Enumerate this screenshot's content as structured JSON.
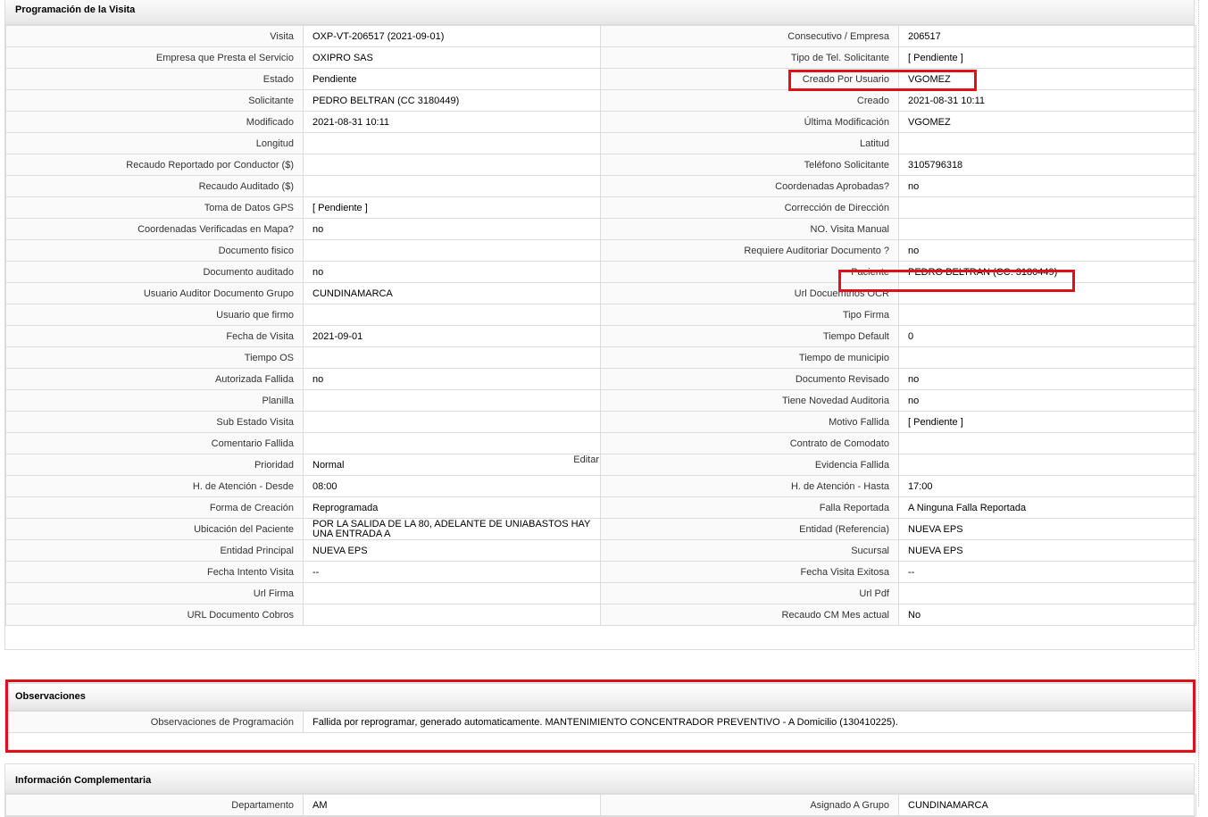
{
  "sections": {
    "programacion": {
      "title": "Programación de la Visita",
      "rows": [
        {
          "l1": "Visita",
          "v1": "OXP-VT-206517 (2021-09-01)",
          "l2": "Consecutivo / Empresa",
          "v2": "206517"
        },
        {
          "l1": "Empresa que Presta el Servicio",
          "v1": "OXIPRO SAS",
          "l2": "Tipo de Tel. Solicitante",
          "v2": "[ Pendiente ]"
        },
        {
          "l1": "Estado",
          "v1": "Pendiente",
          "l2": "Creado Por Usuario",
          "v2": "VGOMEZ"
        },
        {
          "l1": "Solicitante",
          "v1": "PEDRO BELTRAN (CC 3180449)",
          "l2": "Creado",
          "v2": "2021-08-31 10:11"
        },
        {
          "l1": "Modificado",
          "v1": "2021-08-31 10:11",
          "l2": "Última Modificación",
          "v2": " VGOMEZ"
        },
        {
          "l1": "Longitud",
          "v1": "",
          "l2": "Latitud",
          "v2": ""
        },
        {
          "l1": "Recaudo Reportado por Conductor ($)",
          "v1": "",
          "l2": "Teléfono Solicitante",
          "v2": "3105796318"
        },
        {
          "l1": "Recaudo Auditado ($)",
          "v1": "",
          "l2": "Coordenadas Aprobadas?",
          "v2": " no"
        },
        {
          "l1": "Toma de Datos GPS",
          "v1": "[ Pendiente ]",
          "l2": "Corrección de Dirección",
          "v2": ""
        },
        {
          "l1": "Coordenadas Verificadas en Mapa?",
          "v1": " no",
          "l2": "NO. Visita Manual",
          "v2": ""
        },
        {
          "l1": "Documento fisico",
          "v1": "",
          "l2": "Requiere Auditoriar Documento ?",
          "v2": " no"
        },
        {
          "l1": "Documento auditado",
          "v1": " no",
          "l2": "Paciente",
          "v2": "PEDRO BELTRAN (CC: 3180449)"
        },
        {
          "l1": "Usuario Auditor Documento Grupo",
          "v1": "CUNDINAMARCA",
          "l2": "Url Docuemtnos OCR",
          "v2": ""
        },
        {
          "l1": "Usuario que firmo",
          "v1": "",
          "l2": "Tipo Firma",
          "v2": ""
        },
        {
          "l1": "Fecha de Visita",
          "v1": " 2021-09-01",
          "l2": "Tiempo Default",
          "v2": "0"
        },
        {
          "l1": "Tiempo OS",
          "v1": "",
          "l2": "Tiempo de municipio",
          "v2": ""
        },
        {
          "l1": "Autorizada Fallida",
          "v1": " no",
          "l2": "Documento Revisado",
          "v2": " no"
        },
        {
          "l1": "Planilla",
          "v1": "",
          "l2": "Tiene Novedad Auditoria",
          "v2": " no"
        },
        {
          "l1": "Sub Estado Visita",
          "v1": "",
          "l2": "Motivo Fallida",
          "v2": "[ Pendiente ]"
        },
        {
          "l1": "Comentario Fallida",
          "v1": "",
          "l2": "Contrato de Comodato",
          "v2": ""
        },
        {
          "l1": "Prioridad",
          "v1": "Normal",
          "l2": "Evidencia Fallida",
          "v2": ""
        },
        {
          "l1": "H. de Atención - Desde",
          "v1": "08:00",
          "l2": "H. de Atención - Hasta",
          "v2": "17:00"
        },
        {
          "l1": "Forma de Creación",
          "v1": "Reprogramada",
          "l2": "Falla Reportada",
          "v2": "A Ninguna Falla Reportada"
        },
        {
          "l1": "Ubicación del Paciente",
          "v1": "POR LA SALIDA DE LA 80, ADELANTE DE UNIABASTOS HAY UNA ENTRADA A",
          "l2": "Entidad (Referencia)",
          "v2": "NUEVA EPS"
        },
        {
          "l1": "Entidad Principal",
          "v1": "NUEVA EPS",
          "l2": "Sucursal",
          "v2": "NUEVA EPS"
        },
        {
          "l1": "Fecha Intento Visita",
          "v1": " --",
          "l2": "Fecha Visita Exitosa",
          "v2": " --"
        },
        {
          "l1": "Url Firma",
          "v1": "",
          "l2": "Url Pdf",
          "v2": ""
        },
        {
          "l1": "URL Documento Cobros",
          "v1": "",
          "l2": "Recaudo CM Mes actual",
          "v2": "No"
        }
      ],
      "edit_label": "Editar"
    },
    "observaciones": {
      "title": "Observaciones",
      "label": "Observaciones de Programación",
      "value": " Fallida por reprogramar, generado automaticamente. MANTENIMIENTO CONCENTRADOR PREVENTIVO - A Domicilio (130410225)."
    },
    "complementaria": {
      "title": "Información Complementaria",
      "row": {
        "l1": "Departamento",
        "v1": "AM",
        "l2": "Asignado A Grupo",
        "v2": "CUNDINAMARCA"
      }
    }
  },
  "highlight_color": "#e0101a"
}
